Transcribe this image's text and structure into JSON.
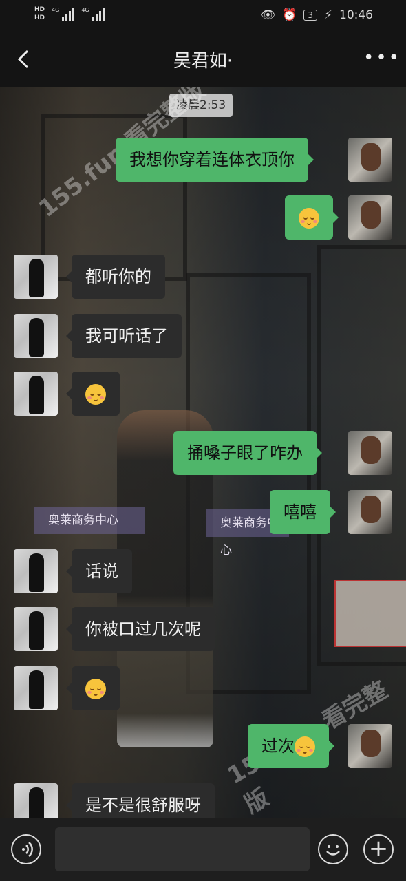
{
  "status_bar": {
    "hd_top": "HD",
    "hd_bottom": "HD",
    "net1": "4G",
    "net2": "4G",
    "battery": "3",
    "time": "10:46"
  },
  "header": {
    "title": "吴君如·"
  },
  "chat": {
    "timestamp": "凌晨2:53",
    "background_signs": [
      "奥莱商务中心",
      "奥莱商务中心"
    ],
    "watermarks": [
      "155.fun 看完整版",
      "155.fun 看完整版"
    ],
    "messages": [
      {
        "side": "right",
        "text": "我想你穿着连体衣顶你",
        "emoji": false
      },
      {
        "side": "right",
        "text": "",
        "emoji": true
      },
      {
        "side": "left",
        "text": "都听你的",
        "emoji": false
      },
      {
        "side": "left",
        "text": "我可听话了",
        "emoji": false
      },
      {
        "side": "left",
        "text": "",
        "emoji": true
      },
      {
        "side": "right",
        "text": "捅嗓子眼了咋办",
        "emoji": false
      },
      {
        "side": "right",
        "text": "嘻嘻",
        "emoji": false
      },
      {
        "side": "left",
        "text": "话说",
        "emoji": false
      },
      {
        "side": "left",
        "text": "你被口过几次呢",
        "emoji": false
      },
      {
        "side": "left",
        "text": "",
        "emoji": true
      },
      {
        "side": "right",
        "text": "过次",
        "emoji": true
      },
      {
        "side": "left",
        "text": "是不是很舒服呀",
        "emoji": false
      }
    ]
  },
  "colors": {
    "sent_bubble": "#4fb66a",
    "received_bubble": "#2c2c2c"
  }
}
